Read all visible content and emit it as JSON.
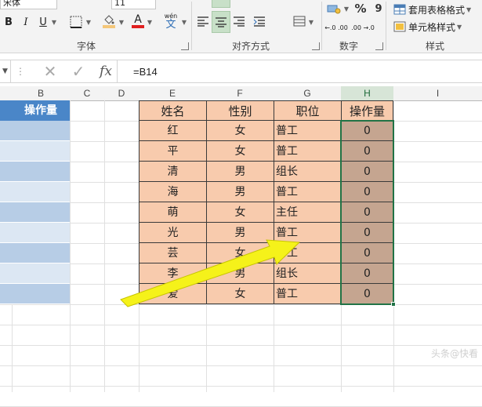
{
  "ribbon": {
    "font_name": "宋体",
    "font_size": "11",
    "italic_label": "I",
    "underline_label": "U",
    "font_color_label": "A",
    "phonetic_label": "wén",
    "percent_label": "%",
    "comma_label": "9",
    "dec_increase_label": "←.0 .00",
    "dec_decrease_label": ".00 →.0",
    "groups": {
      "font": "字体",
      "alignment": "对齐方式",
      "number": "数字",
      "styles": "样式"
    },
    "styles_buttons": {
      "table_format": "套用表格格式",
      "cell_styles": "单元格样式"
    }
  },
  "formula_bar": {
    "cancel_glyph": "✕",
    "confirm_glyph": "✓",
    "fx_label": "fx",
    "formula": "=B14"
  },
  "columns": [
    "B",
    "C",
    "D",
    "E",
    "F",
    "G",
    "H",
    "I"
  ],
  "selected_column": "H",
  "left_table": {
    "header": "操作量"
  },
  "table": {
    "headers": [
      "姓名",
      "性别",
      "职位",
      "操作量"
    ],
    "rows": [
      [
        "红",
        "女",
        "普工",
        "0"
      ],
      [
        "平",
        "女",
        "普工",
        "0"
      ],
      [
        "清",
        "男",
        "组长",
        "0"
      ],
      [
        "海",
        "男",
        "普工",
        "0"
      ],
      [
        "萌",
        "女",
        "主任",
        "0"
      ],
      [
        "光",
        "男",
        "普工",
        "0"
      ],
      [
        "芸",
        "女",
        "普工",
        "0"
      ],
      [
        "李",
        "男",
        "组长",
        "0"
      ],
      [
        "爱",
        "女",
        "普工",
        "0"
      ]
    ]
  },
  "watermark": "头条@快看"
}
